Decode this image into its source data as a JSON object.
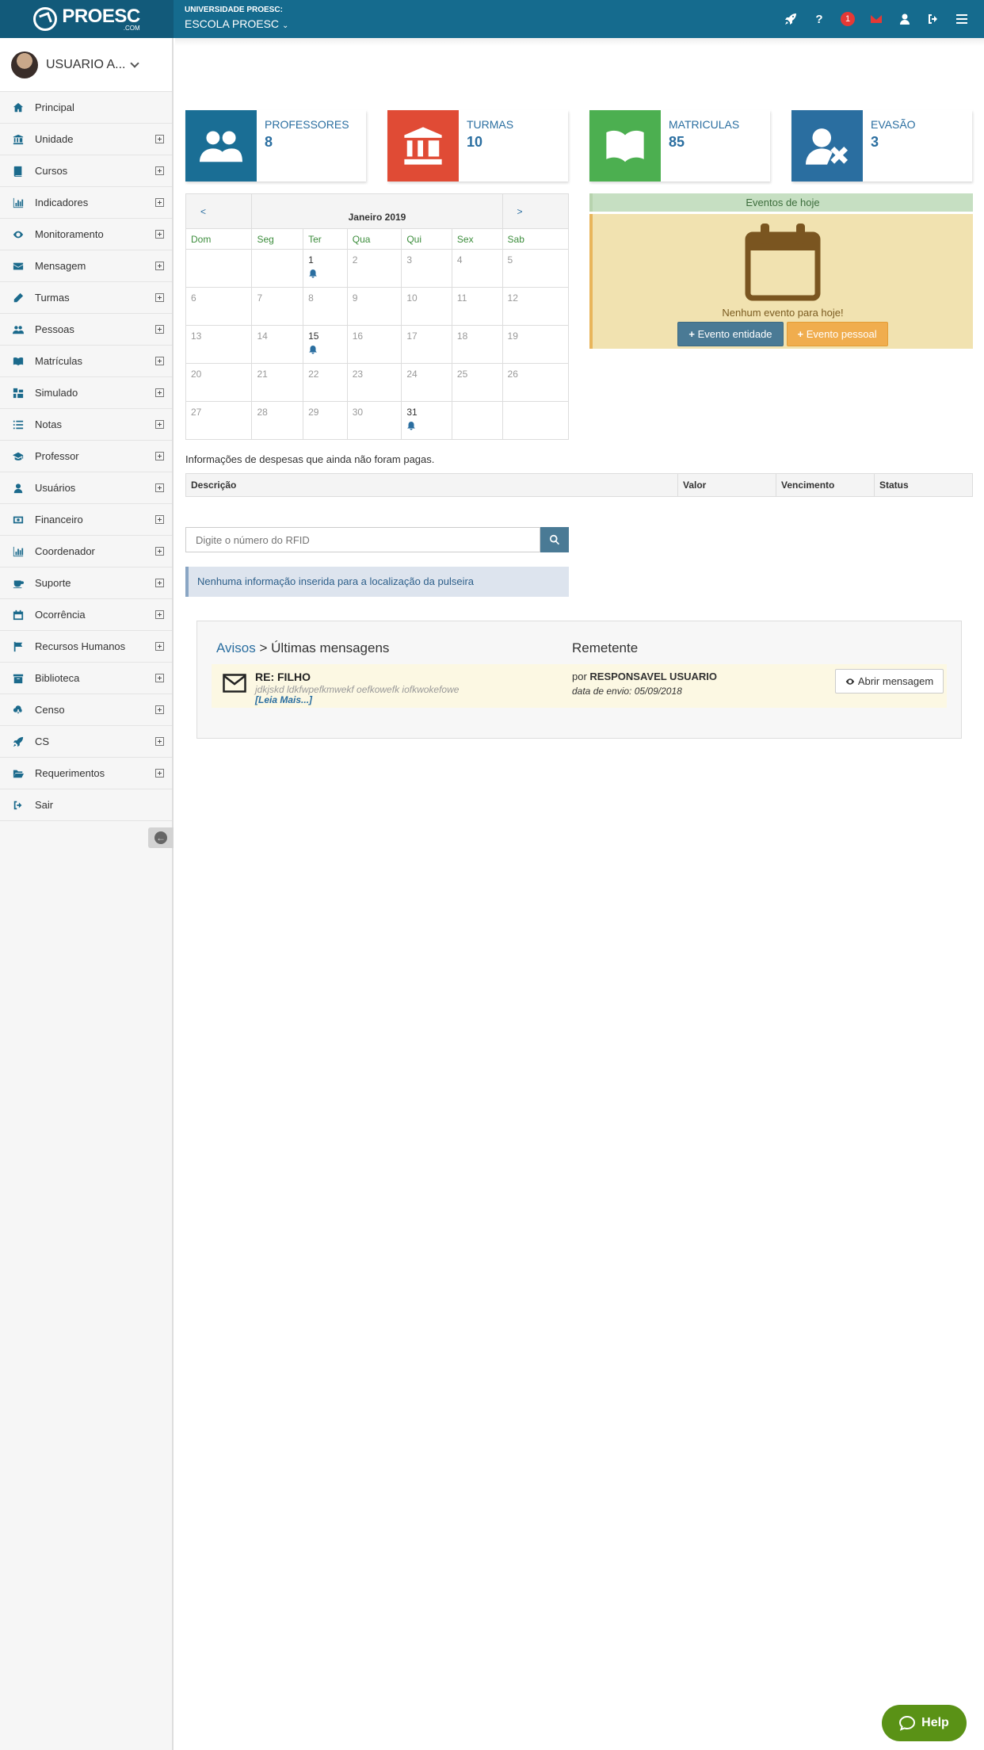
{
  "header": {
    "logo_name": "PROESC",
    "logo_sub": ".COM",
    "institution_label": "UNIVERSIDADE PROESC:",
    "institution_name": "ESCOLA PROESC",
    "notification_count": "1"
  },
  "sidebar": {
    "user_name": "USUARIO A...",
    "items": [
      {
        "label": "Principal",
        "icon": "home-icon",
        "expandable": false
      },
      {
        "label": "Unidade",
        "icon": "bank-icon",
        "expandable": true
      },
      {
        "label": "Cursos",
        "icon": "book-icon",
        "expandable": true
      },
      {
        "label": "Indicadores",
        "icon": "bar-chart-icon",
        "expandable": true
      },
      {
        "label": "Monitoramento",
        "icon": "eye-icon",
        "expandable": true
      },
      {
        "label": "Mensagem",
        "icon": "envelope-icon",
        "expandable": true
      },
      {
        "label": "Turmas",
        "icon": "pencil-icon",
        "expandable": true
      },
      {
        "label": "Pessoas",
        "icon": "users-icon",
        "expandable": true
      },
      {
        "label": "Matrículas",
        "icon": "open-book-icon",
        "expandable": true
      },
      {
        "label": "Simulado",
        "icon": "grid-icon",
        "expandable": true
      },
      {
        "label": "Notas",
        "icon": "list-icon",
        "expandable": true
      },
      {
        "label": "Professor",
        "icon": "graduation-cap-icon",
        "expandable": true
      },
      {
        "label": "Usuários",
        "icon": "user-icon",
        "expandable": true
      },
      {
        "label": "Financeiro",
        "icon": "money-icon",
        "expandable": true
      },
      {
        "label": "Coordenador",
        "icon": "bar-chart-icon",
        "expandable": true
      },
      {
        "label": "Suporte",
        "icon": "coffee-icon",
        "expandable": true
      },
      {
        "label": "Ocorrência",
        "icon": "calendar-icon",
        "expandable": true
      },
      {
        "label": "Recursos Humanos",
        "icon": "flag-icon",
        "expandable": true
      },
      {
        "label": "Biblioteca",
        "icon": "archive-icon",
        "expandable": true
      },
      {
        "label": "Censo",
        "icon": "cloud-download-icon",
        "expandable": true
      },
      {
        "label": "CS",
        "icon": "rocket-icon",
        "expandable": true
      },
      {
        "label": "Requerimentos",
        "icon": "folder-open-icon",
        "expandable": true
      },
      {
        "label": "Sair",
        "icon": "sign-out-icon",
        "expandable": false
      }
    ]
  },
  "stats": [
    {
      "label": "PROFESSORES",
      "value": "8",
      "color": "#1a6e95",
      "icon": "users-icon"
    },
    {
      "label": "TURMAS",
      "value": "10",
      "color": "#e04b35",
      "icon": "bank-icon"
    },
    {
      "label": "MATRICULAS",
      "value": "85",
      "color": "#4caf50",
      "icon": "open-book-icon"
    },
    {
      "label": "EVASÃO",
      "value": "3",
      "color": "#2a6ea0",
      "icon": "user-remove-icon"
    }
  ],
  "calendar": {
    "prev": "<",
    "next": ">",
    "month": "Janeiro 2019",
    "weekdays": [
      "Dom",
      "Seg",
      "Ter",
      "Qua",
      "Qui",
      "Sex",
      "Sab"
    ],
    "weeks": [
      [
        "",
        "",
        "1",
        "2",
        "3",
        "4",
        "5"
      ],
      [
        "6",
        "7",
        "8",
        "9",
        "10",
        "11",
        "12"
      ],
      [
        "13",
        "14",
        "15",
        "16",
        "17",
        "18",
        "19"
      ],
      [
        "20",
        "21",
        "22",
        "23",
        "24",
        "25",
        "26"
      ],
      [
        "27",
        "28",
        "29",
        "30",
        "31",
        "",
        ""
      ]
    ],
    "event_days": [
      "1",
      "15",
      "31"
    ]
  },
  "events": {
    "title": "Eventos de hoje",
    "empty": "Nenhum evento para hoje!",
    "btn_entity": "Evento entidade",
    "btn_personal": "Evento pessoal"
  },
  "expenses": {
    "text": "Informações de despesas que ainda não foram pagas.",
    "columns": [
      "Descrição",
      "Valor",
      "Vencimento",
      "Status"
    ]
  },
  "rfid": {
    "placeholder": "Digite o número do RFID",
    "info": "Nenhuma informação inserida para a localização da pulseira"
  },
  "messages": {
    "breadcrumb_link": "Avisos",
    "breadcrumb_sep": " > ",
    "breadcrumb_current": "Últimas mensagens",
    "sender_header": "Remetente",
    "items": [
      {
        "subject": "RE: FILHO",
        "preview": "jdkjskd ldkfwpefkmwekf oefkowefk iofkwokefowe",
        "more": "[Leia Mais...]",
        "by_prefix": "por ",
        "sender": "RESPONSAVEL USUARIO",
        "date": "data de envio: 05/09/2018",
        "open_label": "Abrir mensagem"
      }
    ]
  },
  "help": {
    "label": "Help"
  }
}
